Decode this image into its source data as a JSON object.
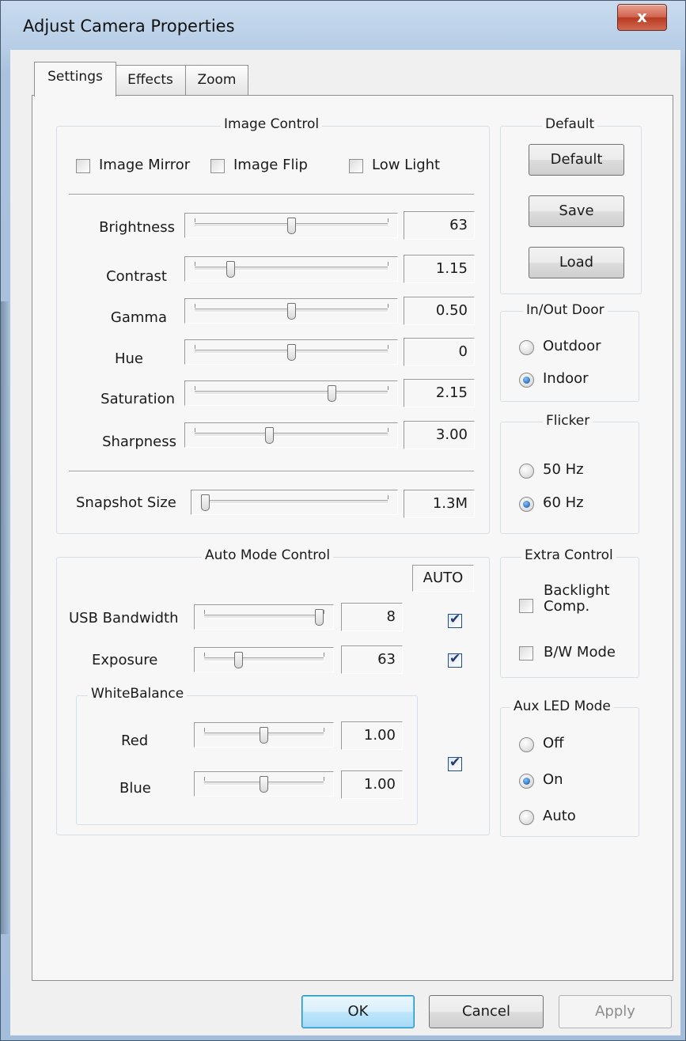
{
  "window": {
    "title": "Adjust Camera Properties",
    "close_label": "x"
  },
  "tabs": [
    {
      "label": "Settings"
    },
    {
      "label": "Effects"
    },
    {
      "label": "Zoom"
    }
  ],
  "image_control": {
    "title": "Image Control",
    "checkboxes": [
      {
        "label": "Image Mirror",
        "checked": false
      },
      {
        "label": "Image Flip",
        "checked": false
      },
      {
        "label": "Low Light",
        "checked": false
      }
    ],
    "sliders": [
      {
        "label": "Brightness",
        "value": "63",
        "level": 0.5
      },
      {
        "label": "Contrast",
        "value": "1.15",
        "level": 0.17
      },
      {
        "label": "Gamma",
        "value": "0.50",
        "level": 0.5
      },
      {
        "label": "Hue",
        "value": "0",
        "level": 0.5
      },
      {
        "label": "Saturation",
        "value": "2.15",
        "level": 0.72
      },
      {
        "label": "Sharpness",
        "value": "3.00",
        "level": 0.38
      }
    ],
    "snapshot": {
      "label": "Snapshot Size",
      "value": "1.3M",
      "level": 0.0
    }
  },
  "default_group": {
    "title": "Default",
    "buttons": [
      "Default",
      "Save",
      "Load"
    ]
  },
  "inout_door": {
    "title": "In/Out Door",
    "options": [
      {
        "label": "Outdoor",
        "selected": false
      },
      {
        "label": "Indoor",
        "selected": true
      }
    ]
  },
  "flicker": {
    "title": "Flicker",
    "options": [
      {
        "label": "50 Hz",
        "selected": false
      },
      {
        "label": "60 Hz",
        "selected": true
      }
    ]
  },
  "auto_mode": {
    "title": "Auto Mode Control",
    "auto_header": "AUTO",
    "sliders": [
      {
        "label": "USB Bandwidth",
        "value": "8",
        "level": 1.0,
        "auto": true
      },
      {
        "label": "Exposure",
        "value": "63",
        "level": 0.27,
        "auto": true
      }
    ],
    "white_balance": {
      "title": "WhiteBalance",
      "auto": true,
      "sliders": [
        {
          "label": "Red",
          "value": "1.00",
          "level": 0.5
        },
        {
          "label": "Blue",
          "value": "1.00",
          "level": 0.5
        }
      ]
    }
  },
  "extra_control": {
    "title": "Extra Control",
    "checkboxes": [
      {
        "label_line1": "Backlight",
        "label_line2": "Comp.",
        "checked": false
      },
      {
        "label": "B/W Mode",
        "checked": false
      }
    ]
  },
  "aux_led": {
    "title": "Aux LED Mode",
    "options": [
      {
        "label": "Off",
        "selected": false
      },
      {
        "label": "On",
        "selected": true
      },
      {
        "label": "Auto",
        "selected": false
      }
    ]
  },
  "footer": {
    "ok": "OK",
    "cancel": "Cancel",
    "apply": "Apply"
  }
}
